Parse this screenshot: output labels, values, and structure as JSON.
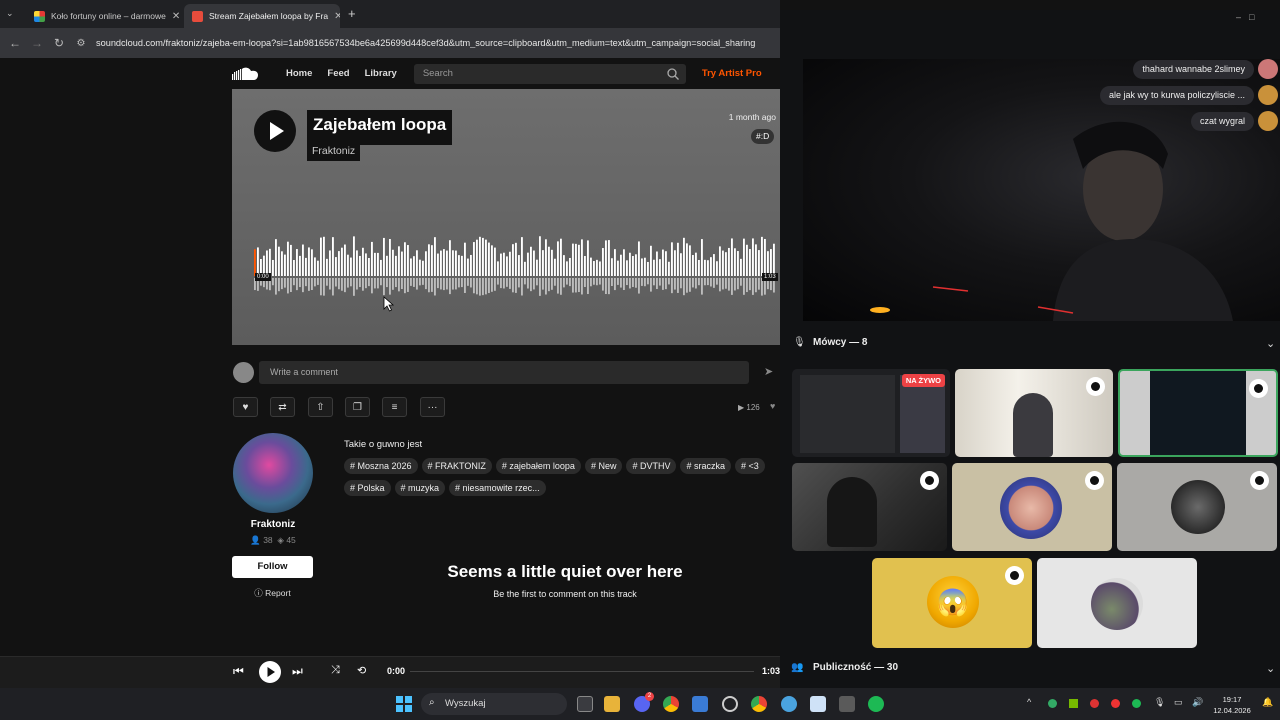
{
  "browser": {
    "tabs": [
      {
        "title": "Koło fortuny online – darmowe",
        "active": false
      },
      {
        "title": "Stream Zajebałem loopa by Fra",
        "active": true
      }
    ],
    "url": "soundcloud.com/fraktoniz/zajeba-em-loopa?si=1ab9816567534be6a425699d448cef3d&utm_source=clipboard&utm_medium=text&utm_campaign=social_sharing"
  },
  "soundcloud": {
    "nav": {
      "home": "Home",
      "feed": "Feed",
      "library": "Library",
      "search_placeholder": "Search",
      "try_artist_pro": "Try Artist Pro"
    },
    "track": {
      "title": "Zajebałem loopa",
      "artist": "Fraktoniz",
      "posted": "1 month ago",
      "hero_tag": "#:D",
      "time_start": "0:00",
      "time_end": "1:03",
      "played_fraction": 0.0
    },
    "comment_placeholder": "Write a comment",
    "plays": "126",
    "user": {
      "name": "Fraktoniz",
      "followers": "38",
      "tracks": "45",
      "follow": "Follow",
      "report": "Report"
    },
    "description": "Takie o guwno jest",
    "tags": [
      "Moszna 2026",
      "FRAKTONIZ",
      "zajebałem loopa",
      "New",
      "DVTHV",
      "sraczka",
      "<3",
      "Polska",
      "muzyka",
      "niesamowite rzec..."
    ],
    "quiet_title": "Seems a little quiet over here",
    "quiet_sub": "Be the first to comment on this track",
    "player": {
      "time_current": "0:00",
      "time_total": "1:03",
      "progress_fraction": 0.0
    }
  },
  "discord": {
    "chat": [
      {
        "text": "thahard wannabe 2slimey"
      },
      {
        "text": "ale jak wy to kurwa policzyliscie ..."
      },
      {
        "text": "czat wygral"
      }
    ],
    "speakers_label": "Mówcy — 8",
    "audience_label": "Publiczność — 30",
    "live_label": "NA ŻYWO"
  },
  "taskbar": {
    "search": "Wyszukaj",
    "time": "19:17",
    "date": "12.04.2026",
    "discord_badge": "2"
  },
  "colors": {
    "accent": "#ff5500",
    "live": "#ed4245",
    "tile_yellow": "#e1c14f"
  }
}
